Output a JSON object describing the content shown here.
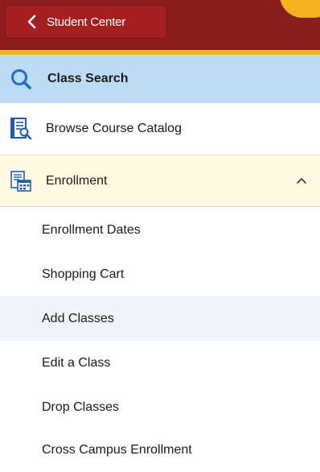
{
  "header": {
    "back_label": "Student Center"
  },
  "nav": {
    "class_search": "Class Search",
    "browse_catalog": "Browse Course Catalog",
    "enrollment": "Enrollment"
  },
  "enrollment_items": [
    {
      "label": "Enrollment Dates"
    },
    {
      "label": "Shopping Cart"
    },
    {
      "label": "Add Classes"
    },
    {
      "label": "Edit a Class"
    },
    {
      "label": "Drop Classes"
    },
    {
      "label": "Cross Campus Enrollment"
    }
  ],
  "colors": {
    "header": "#8c1d1d",
    "accent": "#efb11e",
    "selected_row": "#bcdcf6",
    "expanded_row": "#fffbe2",
    "active_item": "#f1f5fa"
  },
  "icons": {
    "back": "chevron-left-icon",
    "class_search": "search-icon",
    "browse_catalog": "catalog-search-icon",
    "enrollment": "enrollment-calendar-icon",
    "expand": "chevron-up-icon"
  },
  "active_item": "Add Classes"
}
